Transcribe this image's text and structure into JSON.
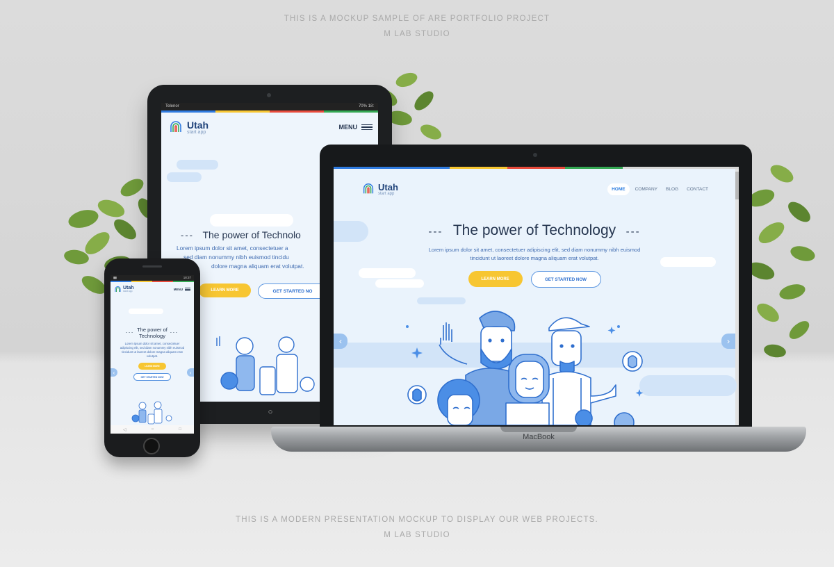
{
  "captions": {
    "top_line1": "THIS IS A MOCKUP SAMPLE OF ARE PORTFOLIO PROJECT",
    "top_line2": "M LAB STUDIO",
    "bottom_line1": "THIS IS A MODERN PRESENTATION MOCKUP TO DISPLAY OUR WEB PROJECTS.",
    "bottom_line2": "M LAB STUDIO"
  },
  "brand_colors": [
    "#2f7be0",
    "#f7c632",
    "#e84b3c",
    "#34a853"
  ],
  "site": {
    "logo_name": "Utah",
    "logo_tagline": "start app",
    "menu_label": "MENU",
    "nav": [
      "HOME",
      "COMPANY",
      "BLOG",
      "CONTACT"
    ],
    "active_nav": "HOME",
    "hero_title": "The power of Technology",
    "hero_title_line1": "The power of",
    "hero_title_line2": "Technology",
    "hero_title_truncated": "The power of Technolo",
    "dashes_left": "---",
    "dashes_right": "---",
    "hero_text": "Lorem ipsum dolor sit amet, consectetuer adipiscing elit, sed diam nonummy nibh euismod tincidunt ut laoreet dolore magna aliquam erat volutpat.",
    "tablet_hero_text": [
      "Lorem ipsum dolor sit amet, consectetuer a",
      "sed diam nonummy nibh euismod tincidu",
      "dolore magna aliquam erat volutpat."
    ],
    "btn_learn_more": "LEARN MORE",
    "btn_get_started": "GET STARTED NOW",
    "btn_get_started_truncated": "GET STARTED NO",
    "prev_icon": "chevron-left-icon",
    "next_icon": "chevron-right-icon"
  },
  "tablet": {
    "carrier": "Telenor",
    "battery": "70%",
    "time": "18:"
  },
  "phone": {
    "time": "18:37"
  },
  "laptop": {
    "brand": "MacBook"
  }
}
